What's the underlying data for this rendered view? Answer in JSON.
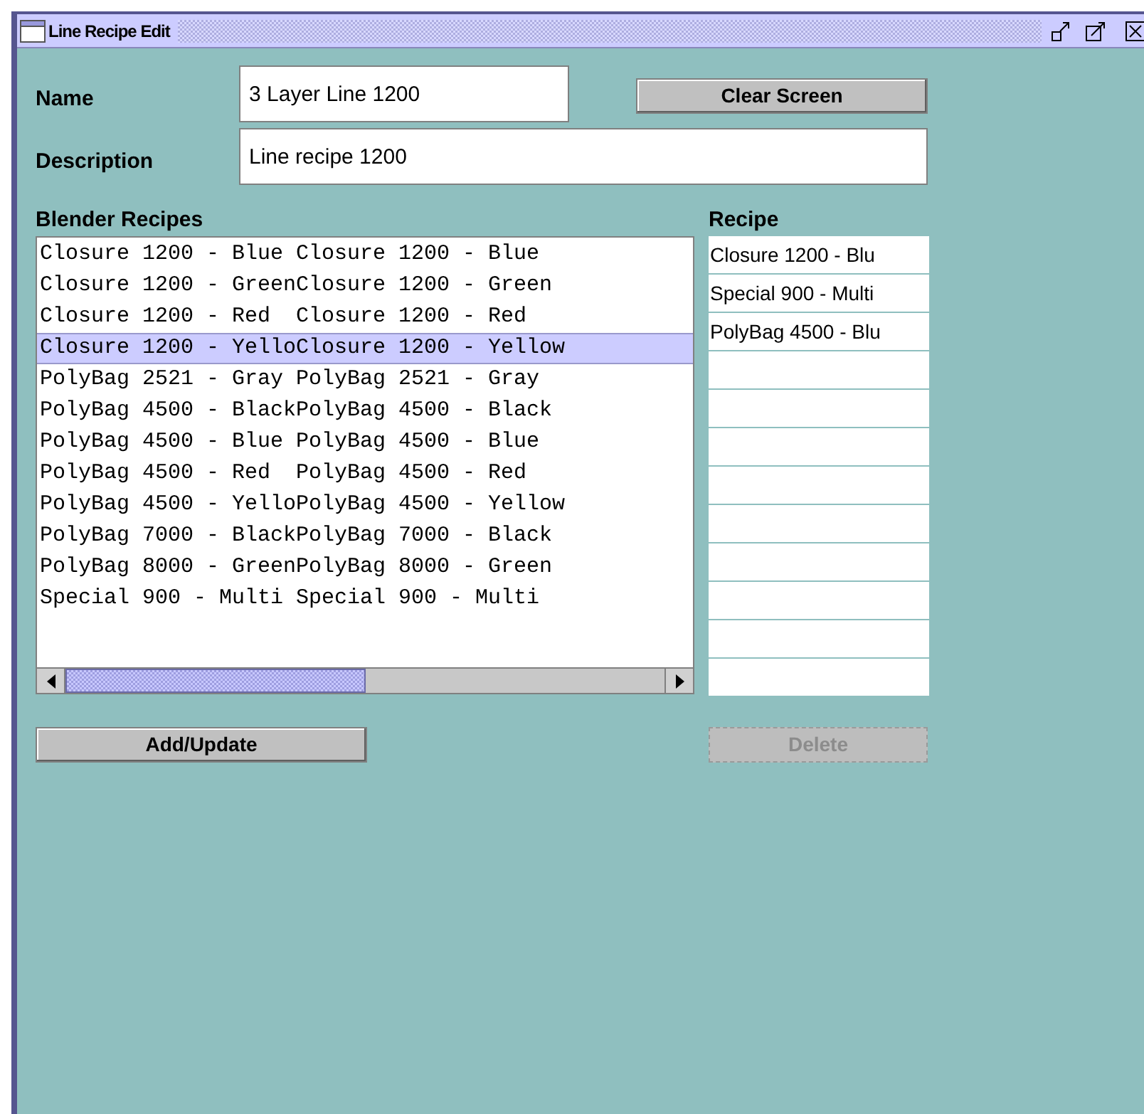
{
  "window": {
    "title": "Line Recipe Edit"
  },
  "name": {
    "label": "Name",
    "value": "3 Layer Line 1200"
  },
  "clear_button": {
    "label": "Clear Screen",
    "disabled": false
  },
  "description": {
    "label": "Description",
    "value": "Line recipe 1200"
  },
  "blender_recipes": {
    "title": "Blender Recipes",
    "items": [
      {
        "text": "Closure 1200 - Blue Closure 1200 - Blue",
        "selected": false
      },
      {
        "text": "Closure 1200 - GreenClosure 1200 - Green",
        "selected": false
      },
      {
        "text": "Closure 1200 - Red  Closure 1200 - Red",
        "selected": false
      },
      {
        "text": "Closure 1200 - YelloClosure 1200 - Yellow",
        "selected": true
      },
      {
        "text": "PolyBag 2521 - Gray PolyBag 2521 - Gray",
        "selected": false
      },
      {
        "text": "PolyBag 4500 - BlackPolyBag 4500 - Black",
        "selected": false
      },
      {
        "text": "PolyBag 4500 - Blue PolyBag 4500 - Blue",
        "selected": false
      },
      {
        "text": "PolyBag 4500 - Red  PolyBag 4500 - Red",
        "selected": false
      },
      {
        "text": "PolyBag 4500 - YelloPolyBag 4500 - Yellow",
        "selected": false
      },
      {
        "text": "PolyBag 7000 - BlackPolyBag 7000 - Black",
        "selected": false
      },
      {
        "text": "PolyBag 8000 - GreenPolyBag 8000 - Green",
        "selected": false
      },
      {
        "text": "Special 900 - Multi Special 900 - Multi",
        "selected": false
      }
    ]
  },
  "recipe": {
    "title": "Recipe",
    "rows": [
      "Closure 1200 - Blu",
      "Special 900 - Multi",
      "PolyBag 4500 - Blu"
    ]
  },
  "add_update_button": {
    "label": "Add/Update",
    "disabled": false
  },
  "delete_button": {
    "label": "Delete",
    "disabled": true
  }
}
